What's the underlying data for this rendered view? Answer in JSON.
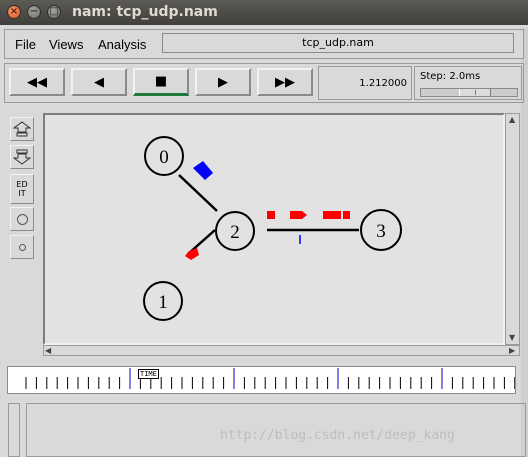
{
  "window": {
    "title": "nam: tcp_udp.nam",
    "controls": [
      "close",
      "minimize",
      "maximize"
    ]
  },
  "menubar": {
    "items": [
      {
        "label": "File",
        "mnemonic": "F"
      },
      {
        "label": "Views",
        "mnemonic": "V"
      },
      {
        "label": "Analysis",
        "mnemonic": "A"
      }
    ],
    "file_title": "tcp_udp.nam"
  },
  "toolbar": {
    "buttons": [
      {
        "name": "rewind",
        "glyph": "◀◀"
      },
      {
        "name": "play-backward",
        "glyph": "◀"
      },
      {
        "name": "stop",
        "glyph": "■"
      },
      {
        "name": "play-forward",
        "glyph": "▶"
      },
      {
        "name": "fast-forward",
        "glyph": "▶▶"
      }
    ],
    "active_button": "stop",
    "current_time": "1.212000",
    "step_label": "Step: 2.0ms"
  },
  "sidetools": {
    "edit_label": "ED IT"
  },
  "network": {
    "nodes": [
      {
        "id": "0"
      },
      {
        "id": "1"
      },
      {
        "id": "2"
      },
      {
        "id": "3"
      }
    ],
    "links": [
      {
        "from": "0",
        "to": "2"
      },
      {
        "from": "1",
        "to": "2"
      },
      {
        "from": "2",
        "to": "3"
      }
    ],
    "packet_colors": {
      "tcp": "#0000ff",
      "udp": "#ff0000",
      "marker": "#0000ff"
    }
  },
  "timeline": {
    "label": "TIME"
  },
  "watermark": "http://blog.csdn.net/deep_kang"
}
